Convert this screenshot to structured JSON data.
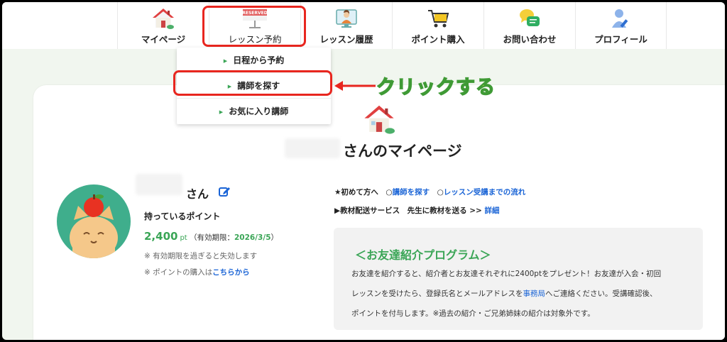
{
  "nav": {
    "items": [
      {
        "label": "マイページ",
        "icon": "home-icon"
      },
      {
        "label": "レッスン予約",
        "icon": "reserved-sign-icon"
      },
      {
        "label": "レッスン履歴",
        "icon": "teacher-screen-icon"
      },
      {
        "label": "ポイント購入",
        "icon": "shopping-cart-icon"
      },
      {
        "label": "お問い合わせ",
        "icon": "chat-bubbles-icon"
      },
      {
        "label": "プロフィール",
        "icon": "user-profile-icon"
      }
    ]
  },
  "dropdown": {
    "items": [
      "日程から予約",
      "講師を探す",
      "お気に入り講師"
    ]
  },
  "annotation": {
    "callout": "クリックする"
  },
  "mypage": {
    "title": "さんのマイページ",
    "user_suffix": "さん",
    "points_label": "持っているポイント",
    "points_value": "2,400",
    "points_unit": "pt",
    "expiry_prefix": "（有効期限：",
    "expiry_date": "2026/3/5",
    "expiry_suffix": "）",
    "note_expire": "※ 有効期限を過ぎると失効します",
    "note_purchase_prefix": "※ ポイントの購入は",
    "note_purchase_link": "こちらから"
  },
  "info": {
    "first_prefix": "★初めて方へ　○",
    "find_teacher_link": "講師を探す",
    "circle2": "　○",
    "flow_link": "レッスン受講までの流れ",
    "delivery_text": "▶教材配送サービス　先生に教材を送る >> ",
    "detail_link": "詳細"
  },
  "friend": {
    "title": "＜お友達紹介プログラム＞",
    "line1": "お友達を紹介すると、紹介者とお友達それぞれに2400ptをプレゼント！お友達が入会・初回",
    "line2_prefix": "レッスンを受けたら、登録氏名とメールアドレスを",
    "line2_link": "事務局",
    "line2_suffix": "へご連絡ください。受講確認後、",
    "line3": "ポイントを付与します。※過去の紹介・ご兄弟姉妹の紹介は対象外です。"
  },
  "colors": {
    "accent_green": "#3aa556",
    "highlight_red": "#e8261f",
    "link_blue": "#1a64d6",
    "avatar_bg": "#3fae8c"
  }
}
